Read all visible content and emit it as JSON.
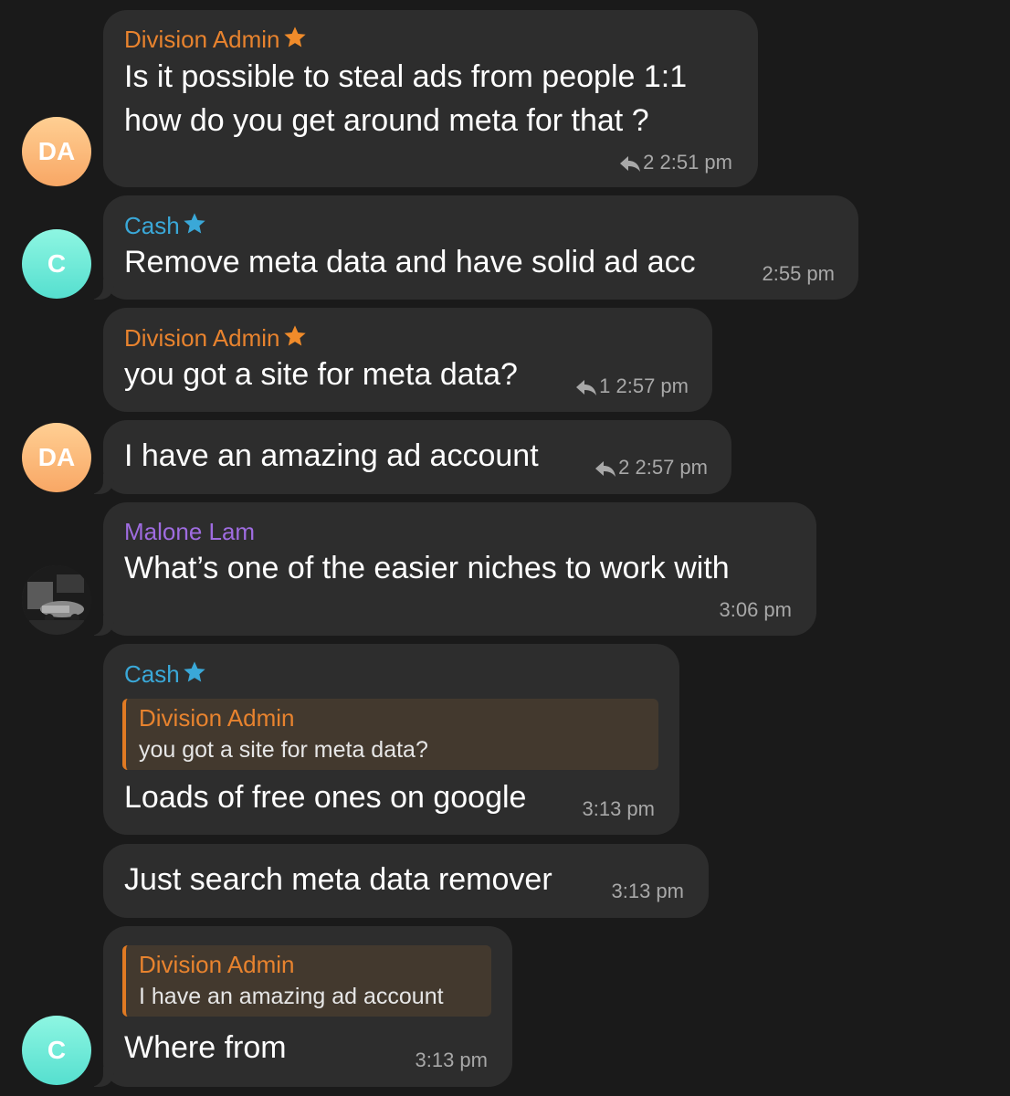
{
  "colors": {
    "background": "#1a1a1a",
    "bubble": "#2d2d2d",
    "admin_name": "#e8832e",
    "cash_name": "#3aa8d8",
    "malone_name": "#9f6ce0",
    "quote_background": "#43392e",
    "meta_text": "#a8a8a8"
  },
  "avatars": {
    "da1": "DA",
    "c1": "C",
    "da2": "DA",
    "c2": "C",
    "malone_icon": "profile-photo"
  },
  "messages": [
    {
      "sender": "Division Admin",
      "sender_icon": "star-icon",
      "lines": [
        "Is it possible to steal ads from people 1:1",
        "how do you get around meta for that ?"
      ],
      "replies": "2",
      "time": "2:51 pm"
    },
    {
      "sender": "Cash",
      "sender_icon": "star-icon",
      "text": "Remove meta data and have solid ad acc",
      "time": "2:55 pm"
    },
    {
      "sender": "Division Admin",
      "sender_icon": "star-icon",
      "text": "you got a site for meta data?",
      "replies": "1",
      "time": "2:57 pm"
    },
    {
      "text": "I have an amazing ad account",
      "replies": "2",
      "time": "2:57 pm"
    },
    {
      "sender": "Malone Lam",
      "text": "What’s one of the easier niches to work with",
      "time": "3:06 pm"
    },
    {
      "sender": "Cash",
      "sender_icon": "star-icon",
      "quote": {
        "name": "Division Admin",
        "text": "you got a site for meta data?"
      },
      "text": "Loads of free ones on google",
      "time": "3:13 pm"
    },
    {
      "text": "Just search meta data remover",
      "time": "3:13 pm"
    },
    {
      "quote": {
        "name": "Division Admin",
        "text": "I have an amazing ad account"
      },
      "text": "Where from",
      "time": "3:13 pm"
    }
  ]
}
